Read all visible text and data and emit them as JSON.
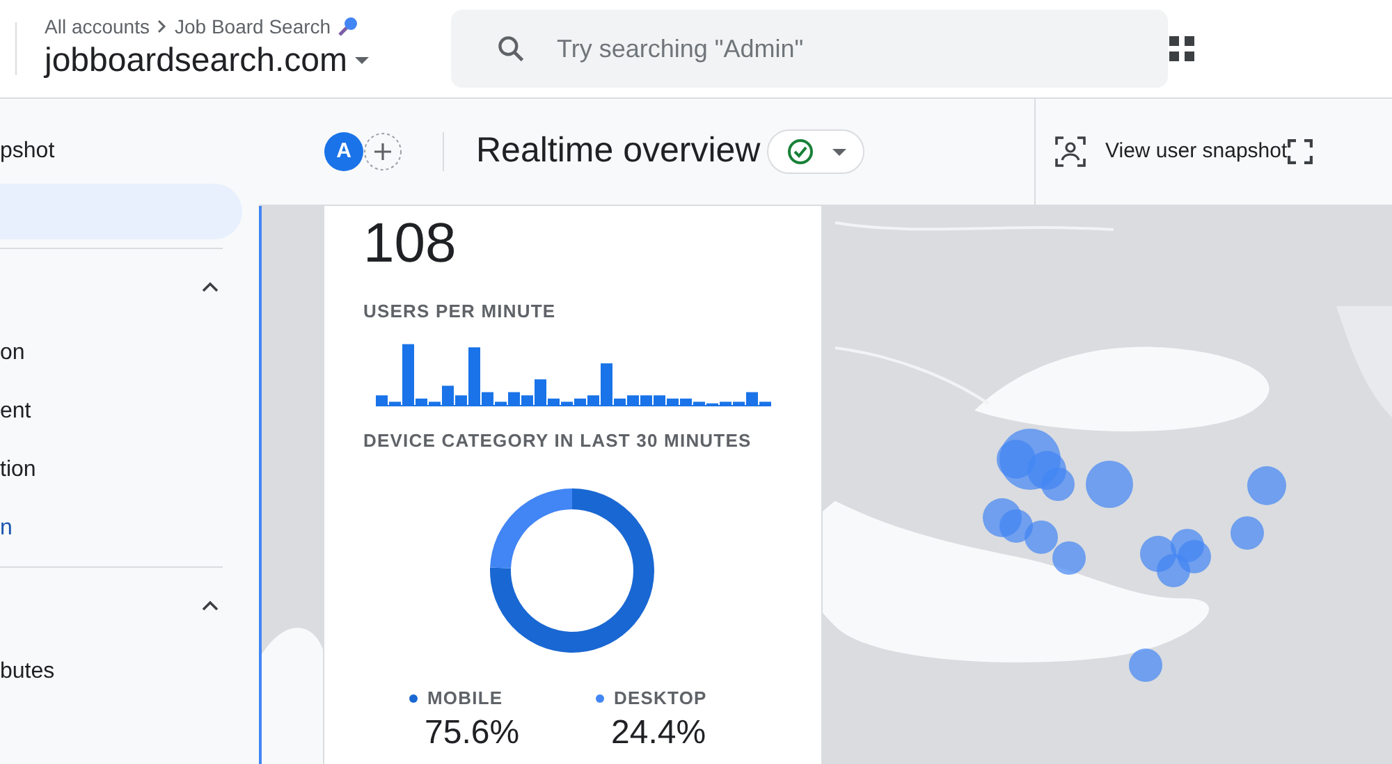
{
  "header": {
    "breadcrumb": [
      "All accounts",
      "Job Board Search"
    ],
    "property": "jobboardsearch.com",
    "search": {
      "placeholder": "Try searching \"Admin\""
    }
  },
  "sidebar": {
    "top_items": [
      {
        "label": "pshot",
        "selected": false
      },
      {
        "selected": true
      }
    ],
    "sections": [
      {
        "expanded": true,
        "items": [
          {
            "label": "on",
            "kind": "item"
          },
          {
            "label": "ent",
            "kind": "item"
          },
          {
            "label": "tion",
            "kind": "item"
          },
          {
            "label": "n",
            "kind": "link"
          }
        ]
      },
      {
        "expanded": true,
        "items": [
          {
            "label": "butes",
            "kind": "item"
          }
        ]
      }
    ]
  },
  "toolbar": {
    "avatar": "A",
    "title": "Realtime overview",
    "status_ok": true,
    "snapshot_button": "View user snapshot"
  },
  "card": {
    "users_count": "108",
    "users_per_minute_title": "USERS PER MINUTE",
    "device_title": "DEVICE CATEGORY IN LAST 30 MINUTES",
    "chart_data": {
      "type": "donut",
      "categories": [
        "MOBILE",
        "DESKTOP"
      ],
      "values": [
        75.6,
        24.4
      ]
    },
    "legend": [
      {
        "value": "75.6%",
        "color": "#1967d2"
      },
      {
        "value": "24.4%",
        "color": "#4285f4"
      }
    ]
  }
}
